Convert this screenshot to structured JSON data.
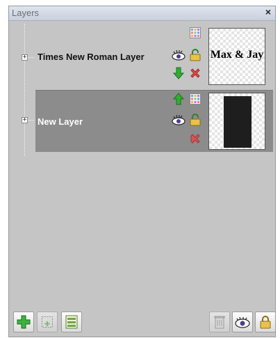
{
  "window": {
    "title": "Layers",
    "close_label": "×"
  },
  "layers": [
    {
      "name": "Times New Roman Layer",
      "thumbnail_text": "Max & Jay",
      "expander": "+",
      "selected": false
    },
    {
      "name": "New Layer",
      "expander": "+",
      "selected": true
    }
  ],
  "toolbar": {
    "left": [
      "add-layer",
      "duplicate-layer",
      "layer-properties"
    ],
    "right": [
      "delete-layer",
      "toggle-visibility",
      "lock-layer"
    ]
  },
  "colors": {
    "panel_bg": "#c5c5c5",
    "selected_row": "#8c8c8c",
    "title_text": "#6d6d6d",
    "arrow_green": "#2fae2f",
    "delete_red": "#e24a4a"
  }
}
